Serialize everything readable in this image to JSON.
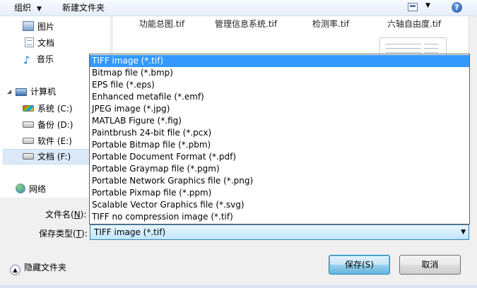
{
  "toolbar": {
    "organize_label": "组织",
    "new_folder_label": "新建文件夹",
    "help_label": "?"
  },
  "nav": {
    "items": [
      {
        "label": "图片",
        "icon": "pictures-icon"
      },
      {
        "label": "文档",
        "icon": "documents-icon"
      },
      {
        "label": "音乐",
        "icon": "music-icon"
      },
      {
        "label": "计算机",
        "icon": "computer-icon"
      },
      {
        "label": "系统 (C:)",
        "icon": "system-drive-icon"
      },
      {
        "label": "备份 (D:)",
        "icon": "drive-icon"
      },
      {
        "label": "软件 (E:)",
        "icon": "drive-icon"
      },
      {
        "label": "文档 (F:)",
        "icon": "drive-icon",
        "selected": true
      },
      {
        "label": "网络",
        "icon": "network-icon"
      }
    ]
  },
  "files": [
    {
      "name": "功能总图.tif"
    },
    {
      "name": "管理信息系统.tif"
    },
    {
      "name": "检测率.tif"
    },
    {
      "name": "六轴自由度.tif"
    }
  ],
  "form": {
    "filename_label": "文件名(",
    "filename_key": "N",
    "filename_suffix": "):",
    "filename_value": "",
    "savetype_label": "保存类型(",
    "savetype_key": "T",
    "savetype_suffix": "):",
    "savetype_value": "TIFF image (*.tif)"
  },
  "dropdown": {
    "options": [
      "TIFF image (*.tif)",
      "Bitmap file (*.bmp)",
      "EPS file (*.eps)",
      "Enhanced metafile (*.emf)",
      "JPEG image (*.jpg)",
      "MATLAB Figure (*.fig)",
      "Paintbrush 24-bit file (*.pcx)",
      "Portable Bitmap file (*.pbm)",
      "Portable Document Format (*.pdf)",
      "Portable Graymap file (*.pgm)",
      "Portable Network Graphics file (*.png)",
      "Portable Pixmap file (*.ppm)",
      "Scalable Vector Graphics file (*.svg)",
      "TIFF no compression image (*.tif)"
    ],
    "selected_index": 0
  },
  "footer": {
    "hide_folders_label": "隐藏文件夹",
    "save_label": "保存(S)",
    "cancel_label": "取消"
  }
}
